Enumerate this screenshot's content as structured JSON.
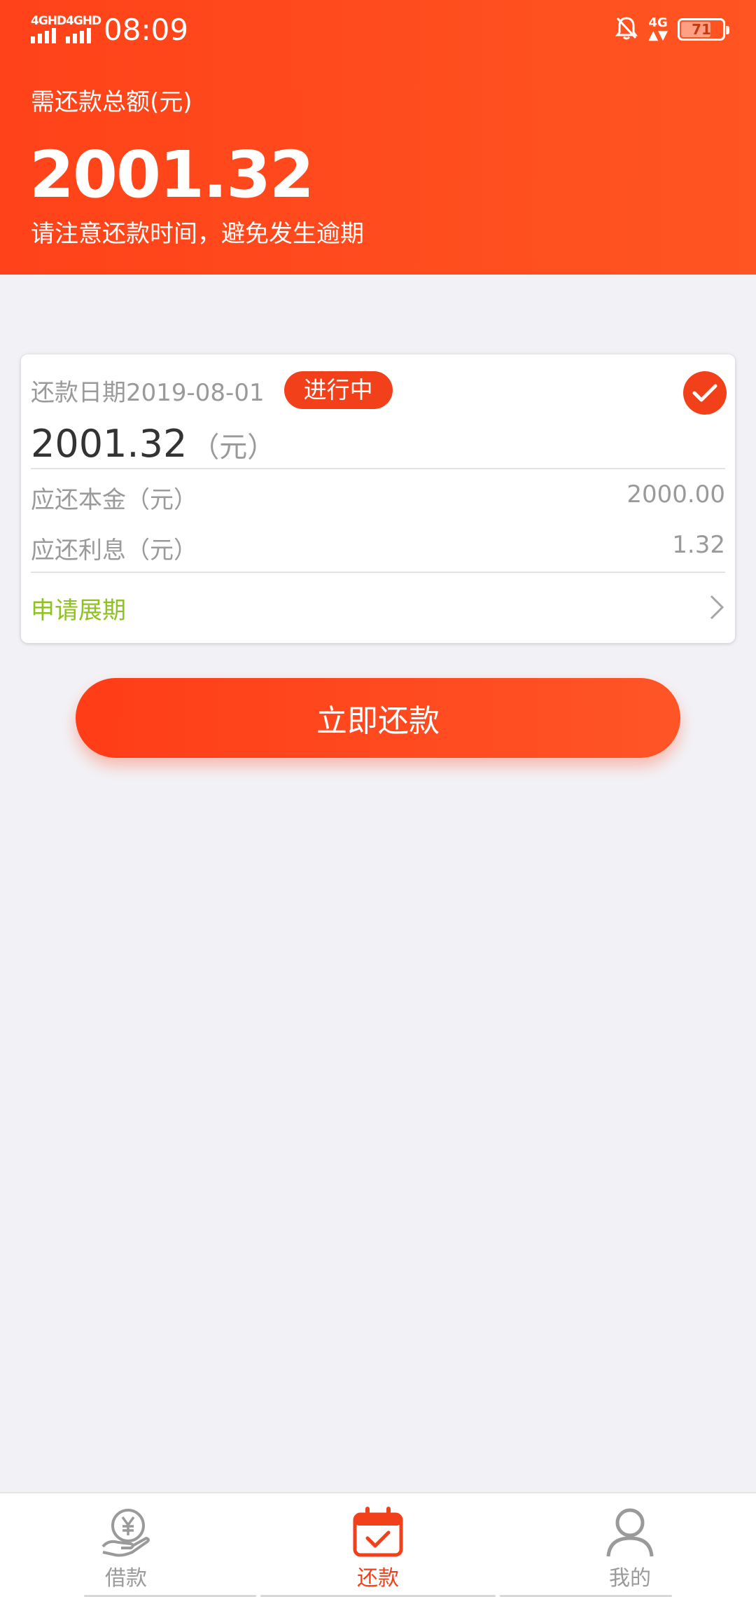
{
  "statusbar": {
    "signal1_label": "4GHD",
    "signal2_label": "4GHD",
    "time": "08:09",
    "network_label": "4G",
    "battery": "71"
  },
  "header": {
    "label": "需还款总额(元)",
    "amount": "2001.32",
    "tip": "请注意还款时间，避免发生逾期"
  },
  "card": {
    "due_date": "还款日期2019-08-01",
    "status_badge": "进行中",
    "amount": "2001.32",
    "amount_unit": "（元）",
    "rows": [
      {
        "label": "应还本金（元）",
        "value": "2000.00"
      },
      {
        "label": "应还利息（元）",
        "value": "1.32"
      }
    ],
    "extend_label": "申请展期"
  },
  "pay_button": "立即还款",
  "tabs": [
    {
      "label": "借款",
      "icon": "loan-hand-yuan-icon"
    },
    {
      "label": "还款",
      "icon": "calendar-check-icon"
    },
    {
      "label": "我的",
      "icon": "person-icon"
    }
  ],
  "colors": {
    "primary": "#f2401b",
    "accent_green": "#8dc21f",
    "muted_text": "#9a9a9a"
  }
}
